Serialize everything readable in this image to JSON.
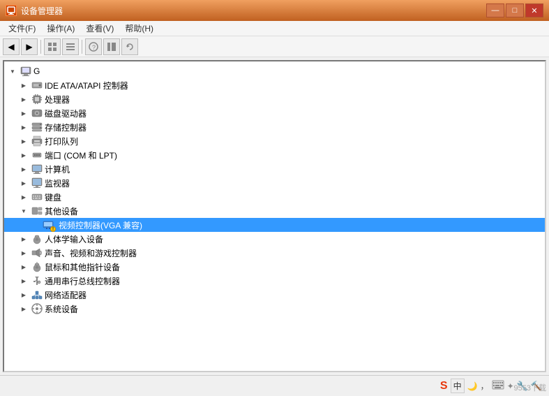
{
  "window": {
    "title": "设备管理器",
    "icon": "🖥"
  },
  "titlebar": {
    "minimize_label": "—",
    "maximize_label": "□",
    "close_label": "✕"
  },
  "menubar": {
    "items": [
      {
        "label": "文件(F)"
      },
      {
        "label": "操作(A)"
      },
      {
        "label": "查看(V)"
      },
      {
        "label": "帮助(H)"
      }
    ]
  },
  "toolbar": {
    "buttons": [
      {
        "name": "back",
        "icon": "◀"
      },
      {
        "name": "forward",
        "icon": "▶"
      },
      {
        "name": "view1",
        "icon": "▦"
      },
      {
        "name": "view2",
        "icon": "▤"
      },
      {
        "name": "help",
        "icon": "?"
      },
      {
        "name": "view3",
        "icon": "▥"
      },
      {
        "name": "refresh",
        "icon": "↻"
      }
    ]
  },
  "tree": {
    "root": {
      "label": "G",
      "icon": "🖥",
      "expanded": true
    },
    "items": [
      {
        "id": "ide",
        "label": "IDE ATA/ATAPI 控制器",
        "icon": "🔌",
        "indent": 1,
        "expanded": false,
        "has_children": true
      },
      {
        "id": "cpu",
        "label": "处理器",
        "icon": "💻",
        "indent": 1,
        "expanded": false,
        "has_children": true
      },
      {
        "id": "disk",
        "label": "磁盘驱动器",
        "icon": "💾",
        "indent": 1,
        "expanded": false,
        "has_children": true
      },
      {
        "id": "storage",
        "label": "存储控制器",
        "icon": "🗄",
        "indent": 1,
        "expanded": false,
        "has_children": true
      },
      {
        "id": "print",
        "label": "打印队列",
        "icon": "🖨",
        "indent": 1,
        "expanded": false,
        "has_children": true
      },
      {
        "id": "port",
        "label": "端口 (COM 和 LPT)",
        "icon": "🔌",
        "indent": 1,
        "expanded": false,
        "has_children": true
      },
      {
        "id": "computer",
        "label": "计算机",
        "icon": "🖥",
        "indent": 1,
        "expanded": false,
        "has_children": true
      },
      {
        "id": "monitor",
        "label": "监视器",
        "icon": "🖥",
        "indent": 1,
        "expanded": false,
        "has_children": true
      },
      {
        "id": "keyboard",
        "label": "键盘",
        "icon": "⌨",
        "indent": 1,
        "expanded": false,
        "has_children": true
      },
      {
        "id": "other",
        "label": "其他设备",
        "icon": "❓",
        "indent": 1,
        "expanded": true,
        "has_children": true
      },
      {
        "id": "vga",
        "label": "视频控制器(VGA 兼容)",
        "icon": "🖵",
        "indent": 2,
        "expanded": false,
        "has_children": false,
        "selected": true,
        "warning": true
      },
      {
        "id": "hid",
        "label": "人体学输入设备",
        "icon": "🖱",
        "indent": 1,
        "expanded": false,
        "has_children": true
      },
      {
        "id": "audio",
        "label": "声音、视频和游戏控制器",
        "icon": "🔊",
        "indent": 1,
        "expanded": false,
        "has_children": true
      },
      {
        "id": "mouse",
        "label": "鼠标和其他指针设备",
        "icon": "🖱",
        "indent": 1,
        "expanded": false,
        "has_children": true
      },
      {
        "id": "bus",
        "label": "通用串行总线控制器",
        "icon": "🔌",
        "indent": 1,
        "expanded": false,
        "has_children": true
      },
      {
        "id": "network",
        "label": "网络适配器",
        "icon": "🌐",
        "indent": 1,
        "expanded": false,
        "has_children": true
      },
      {
        "id": "system",
        "label": "系统设备",
        "icon": "⚙",
        "indent": 1,
        "expanded": false,
        "has_children": true
      }
    ]
  },
  "taskbar": {
    "icons": [
      "S",
      "中",
      "🌙",
      "♪",
      "⌨",
      "✦",
      "🔧",
      "🔨"
    ]
  },
  "watermark": "9553下载"
}
